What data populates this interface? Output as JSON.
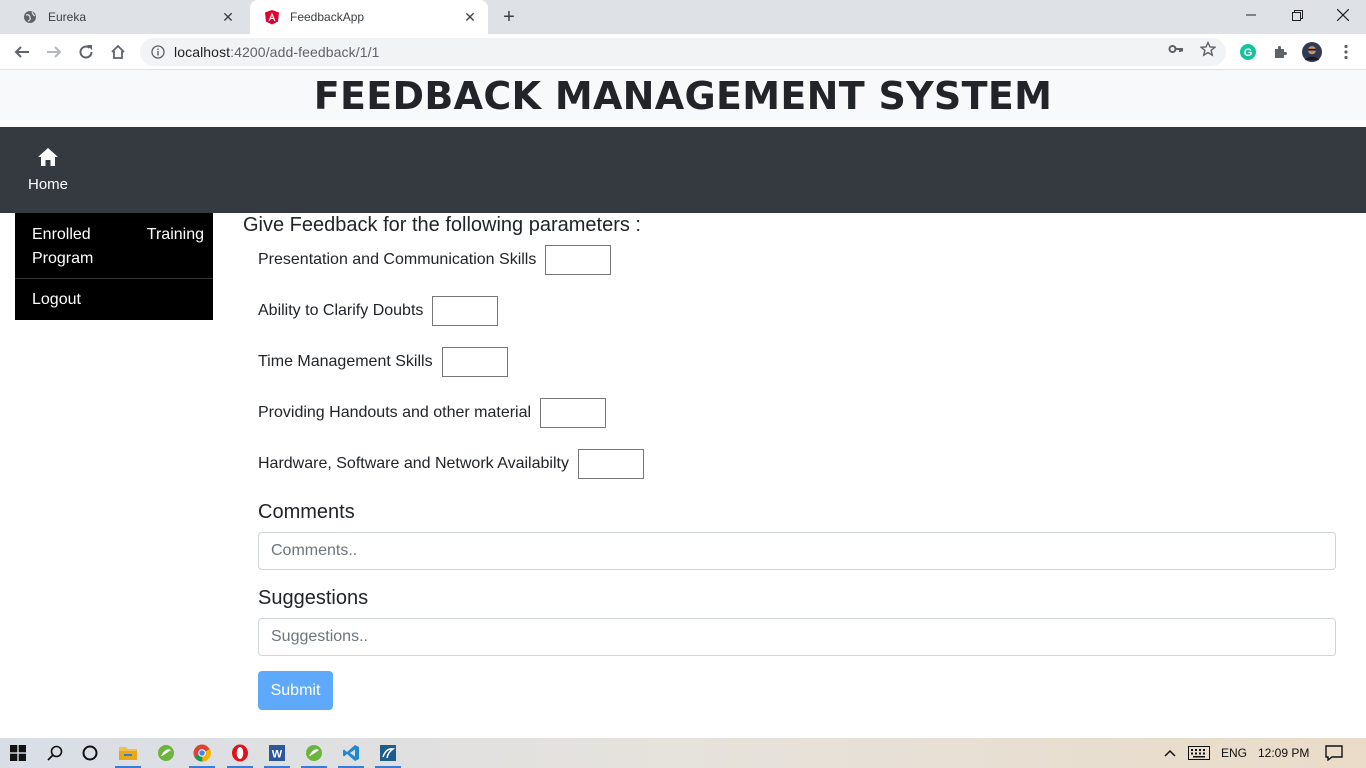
{
  "browser": {
    "tabs": [
      {
        "title": "Eureka",
        "active": false
      },
      {
        "title": "FeedbackApp",
        "active": true
      }
    ],
    "url_host": "localhost",
    "url_path": ":4200/add-feedback/1/1"
  },
  "page": {
    "title": "FEEDBACK MANAGEMENT SYSTEM",
    "nav": {
      "home_label": "Home"
    },
    "sidebar": {
      "enrolled_word1": "Enrolled",
      "enrolled_word2": "Training",
      "enrolled_word3": "Program",
      "logout": "Logout"
    },
    "form": {
      "heading": "Give Feedback for the following parameters :",
      "params": [
        "Presentation and Communication Skills",
        "Ability to Clarify Doubts",
        "Time Management Skills",
        "Providing Handouts and other material",
        "Hardware, Software and Network Availabilty"
      ],
      "comments_label": "Comments",
      "comments_placeholder": "Comments..",
      "suggestions_label": "Suggestions",
      "suggestions_placeholder": "Suggestions..",
      "submit_label": "Submit"
    }
  },
  "taskbar": {
    "language": "ENG",
    "time": "12:09 PM"
  },
  "colors": {
    "navbar": "#343a40",
    "sidebar": "#000000",
    "submit": "#5ea9fb"
  }
}
